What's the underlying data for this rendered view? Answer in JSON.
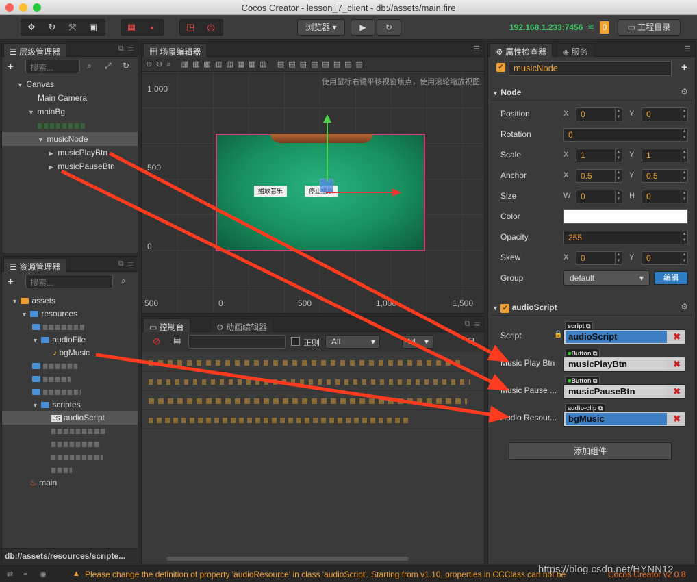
{
  "window": {
    "title": "Cocos Creator - lesson_7_client - db://assets/main.fire"
  },
  "toolbar": {
    "browser_label": "浏览器",
    "ip": "192.168.1.233:7456",
    "badge": "0",
    "project_dir_label": "工程目录"
  },
  "hierarchy": {
    "tab": "层级管理器",
    "search_placeholder": "搜索...",
    "nodes": [
      "Canvas",
      "Main Camera",
      "mainBg",
      "musicNode",
      "musicPlayBtn",
      "musicPauseBtn"
    ]
  },
  "scene": {
    "tab": "场景编辑器",
    "hint": "使用鼠标右键平移视窗焦点，使用滚轮缩放视图",
    "y_labels": [
      "1,000",
      "500",
      "0"
    ],
    "x_labels": [
      "500",
      "0",
      "500",
      "1,000",
      "1,500"
    ],
    "btn_play": "播放音乐",
    "btn_pause": "停止播放"
  },
  "assets": {
    "tab": "资源管理器",
    "search_placeholder": "搜索...",
    "items": [
      "assets",
      "resources",
      "audioFile",
      "bgMusic",
      "scriptes",
      "audioScript",
      "main"
    ],
    "path": "db://assets/resources/scripte..."
  },
  "console": {
    "tab": "控制台",
    "anim_tab": "动画编辑器",
    "regex_label": "正则",
    "filter": "All",
    "font_size": "14"
  },
  "inspector": {
    "tab": "属性检查器",
    "service_tab": "服务",
    "node_name": "musicNode",
    "node_section": "Node",
    "position_label": "Position",
    "position_x": "0",
    "position_y": "0",
    "rotation_label": "Rotation",
    "rotation": "0",
    "scale_label": "Scale",
    "scale_x": "1",
    "scale_y": "1",
    "anchor_label": "Anchor",
    "anchor_x": "0.5",
    "anchor_y": "0.5",
    "size_label": "Size",
    "size_w": "0",
    "size_h": "0",
    "color_label": "Color",
    "opacity_label": "Opacity",
    "opacity": "255",
    "skew_label": "Skew",
    "skew_x": "0",
    "skew_y": "0",
    "group_label": "Group",
    "group": "default",
    "edit_label": "编辑",
    "component_name": "audioScript",
    "script_label": "Script",
    "script_tag": "script",
    "script_value": "audioScript",
    "play_label": "Music Play Btn",
    "play_tag": "Button",
    "play_value": "musicPlayBtn",
    "pause_label": "Music Pause ...",
    "pause_tag": "Button",
    "pause_value": "musicPauseBtn",
    "audio_label": "Audio Resour...",
    "audio_tag": "audio-clip",
    "audio_value": "bgMusic",
    "add_component": "添加组件",
    "axis": {
      "x": "X",
      "y": "Y",
      "w": "W",
      "h": "H"
    }
  },
  "status": {
    "message": "Please change the definition of property 'audioResource' in class 'audioScript'. Starting from v1.10, properties in CCClass can not be",
    "version": "Cocos Creator v2.0.8",
    "watermark": "https://blog.csdn.net/HYNN12"
  },
  "colors": {
    "accent": "#f0a030",
    "arrow": "#ff3b1f",
    "table": "#1a9a6a"
  }
}
